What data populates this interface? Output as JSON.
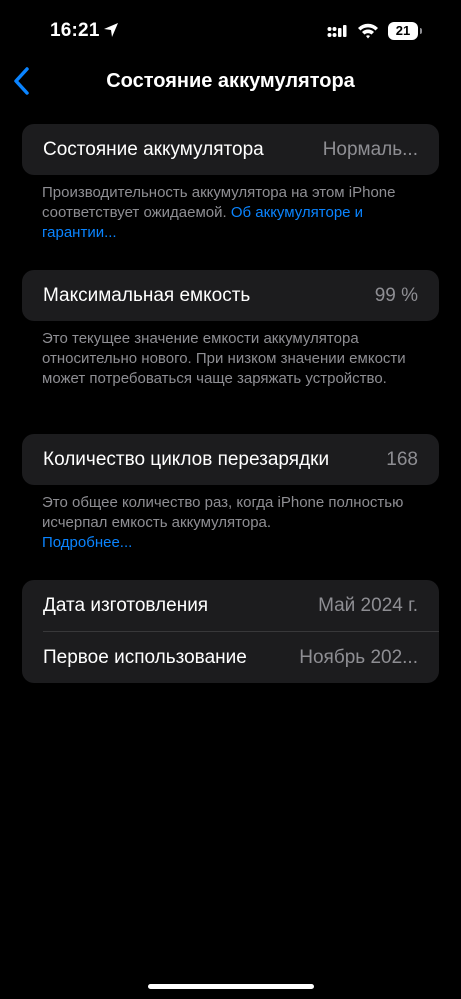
{
  "status_bar": {
    "time": "16:21",
    "battery_level": "21"
  },
  "nav": {
    "title": "Состояние аккумулятора"
  },
  "health_card": {
    "label": "Состояние аккумулятора",
    "value": "Нормаль..."
  },
  "health_footer": {
    "text": "Производительность аккумулятора на этом iPhone соответствует ожидаемой. ",
    "link": "Об аккумуляторе и гарантии..."
  },
  "capacity_card": {
    "label": "Максимальная емкость",
    "value": "99 %"
  },
  "capacity_footer": {
    "text": "Это текущее значение емкости аккумулятора относительно нового. При низком значении емкости может потребоваться чаще заряжать устройство."
  },
  "cycles_card": {
    "label": "Количество циклов перезарядки",
    "value": "168"
  },
  "cycles_footer": {
    "text": "Это общее количество раз, когда iPhone полностью исчерпал емкость аккумулятора.",
    "link": "Подробнее..."
  },
  "dates_card": {
    "manufacture_label": "Дата изготовления",
    "manufacture_value": "Май 2024 г.",
    "first_use_label": "Первое использование",
    "first_use_value": "Ноябрь 202..."
  },
  "colors": {
    "background": "#000000",
    "card": "#1c1c1e",
    "accent": "#0a84ff",
    "secondary_text": "#8e8e93"
  },
  "icons": [
    "location-arrow-icon",
    "cellular-signal-icon",
    "wifi-icon",
    "battery-icon",
    "back-chevron-icon"
  ]
}
